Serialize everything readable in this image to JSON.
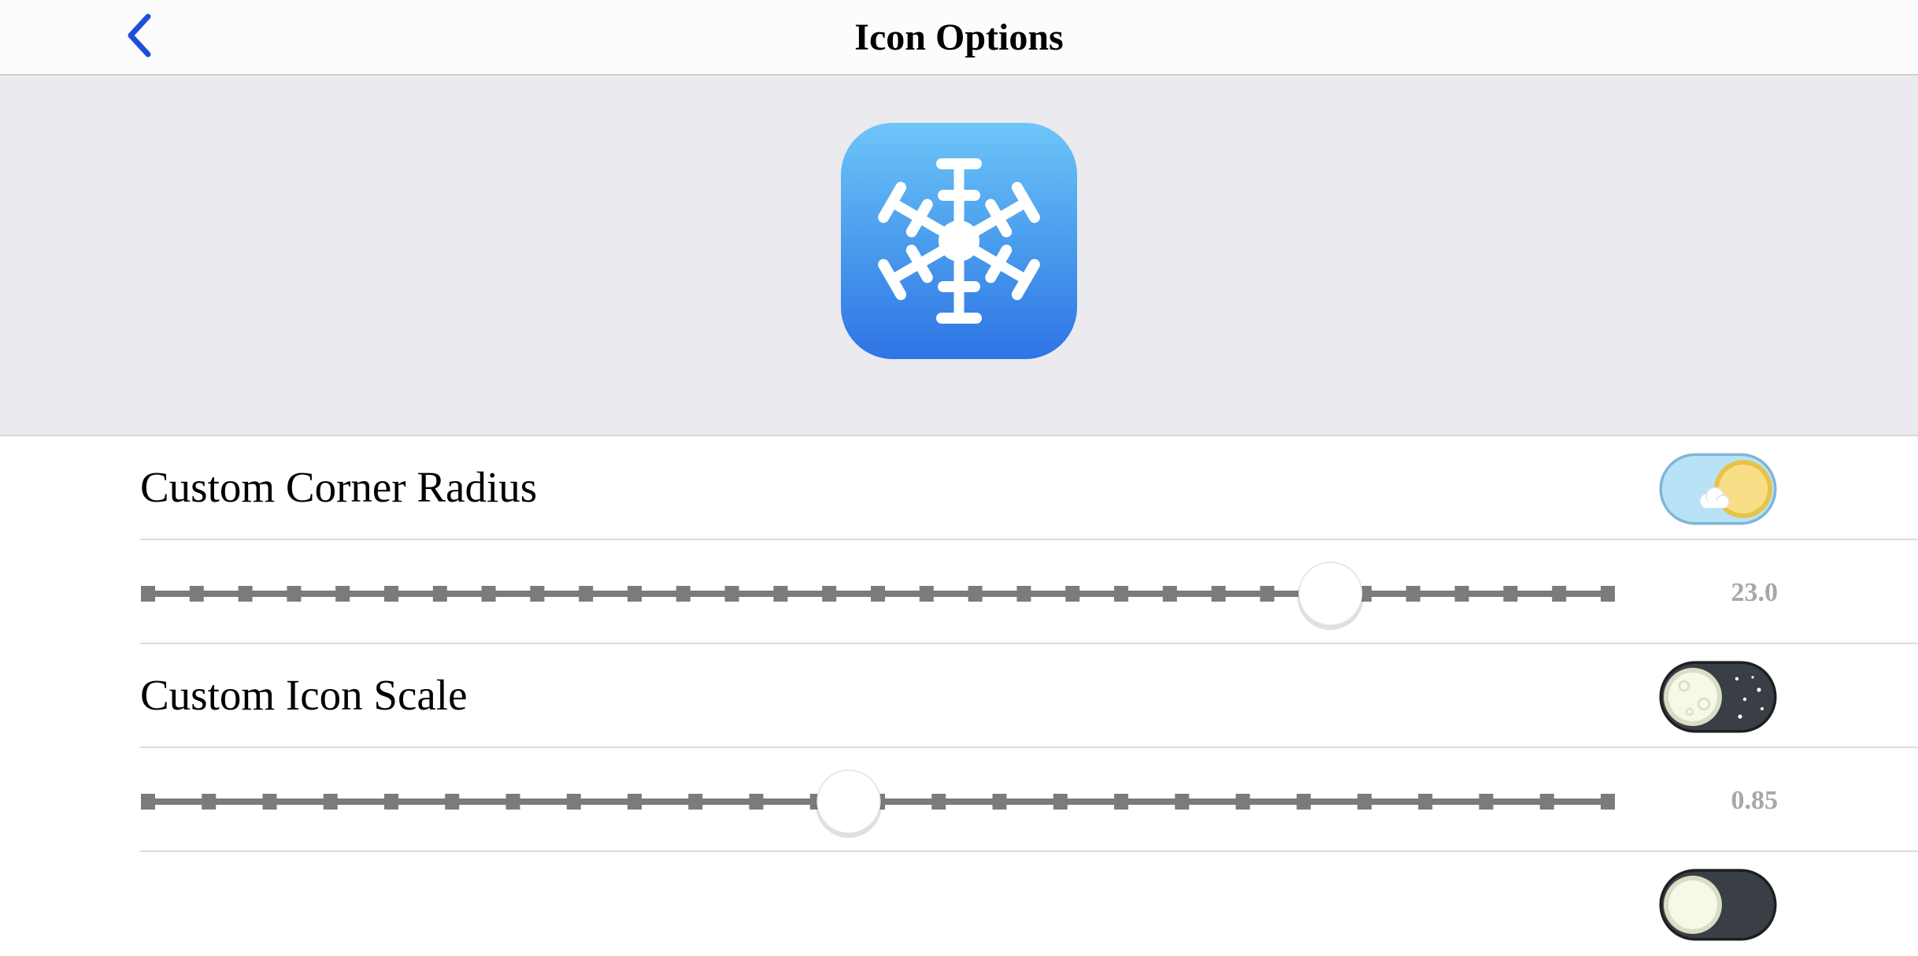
{
  "nav": {
    "title": "Icon Options",
    "back_icon": "chevron-left-icon",
    "accent": "#1f4fd8"
  },
  "preview": {
    "icon": "snowflake-icon",
    "gradient_top": "#6ec5f8",
    "gradient_bottom": "#2f74e6"
  },
  "rows": [
    {
      "label": "Custom Corner Radius",
      "toggle_on": true,
      "toggle_theme": "day-sun-icon"
    },
    {
      "slider_value_text": "23.0",
      "slider_fraction": 0.81
    },
    {
      "label": "Custom Icon Scale",
      "toggle_on": false,
      "toggle_theme": "night-moon-icon"
    },
    {
      "slider_value_text": "0.85",
      "slider_fraction": 0.48
    }
  ]
}
